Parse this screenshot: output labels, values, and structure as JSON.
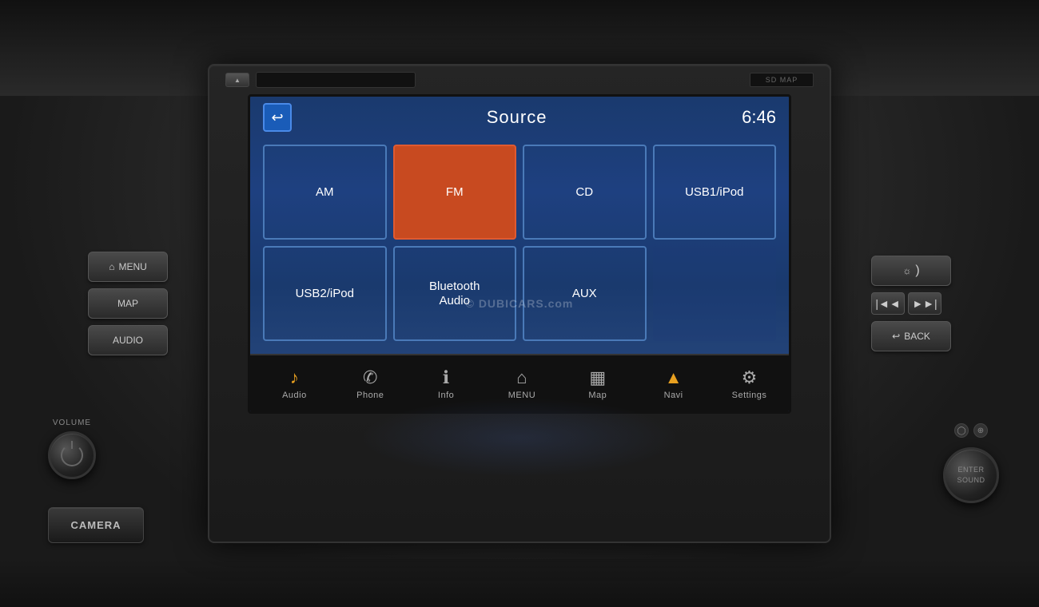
{
  "ui": {
    "screen": {
      "title": "Source",
      "time": "6:46",
      "back_label": "◁"
    },
    "source_buttons": [
      {
        "id": "am",
        "label": "AM",
        "active": false
      },
      {
        "id": "fm",
        "label": "FM",
        "active": true
      },
      {
        "id": "cd",
        "label": "CD",
        "active": false
      },
      {
        "id": "usb1",
        "label": "USB1/iPod",
        "active": false
      },
      {
        "id": "usb2",
        "label": "USB2/iPod",
        "active": false
      },
      {
        "id": "bluetooth",
        "label": "Bluetooth\nAudio",
        "active": false
      },
      {
        "id": "aux",
        "label": "AUX",
        "active": false
      }
    ],
    "nav_items": [
      {
        "id": "audio",
        "label": "Audio",
        "icon": "♪",
        "active": true
      },
      {
        "id": "phone",
        "label": "Phone",
        "icon": "✆",
        "active": false
      },
      {
        "id": "info",
        "label": "Info",
        "icon": "ℹ",
        "active": false
      },
      {
        "id": "menu",
        "label": "MENU",
        "icon": "⌂",
        "active": false
      },
      {
        "id": "map",
        "label": "Map",
        "icon": "▦",
        "active": false
      },
      {
        "id": "navi",
        "label": "Navi",
        "icon": "▲",
        "active": false
      },
      {
        "id": "settings",
        "label": "Settings",
        "icon": "⚙",
        "active": false
      }
    ],
    "left_buttons": [
      {
        "id": "menu",
        "label": "MENU",
        "icon": "⌂"
      },
      {
        "id": "map_btn",
        "label": "MAP",
        "icon": ""
      },
      {
        "id": "audio_btn",
        "label": "AUDIO",
        "icon": ""
      }
    ],
    "right_buttons": [
      {
        "id": "brightness",
        "label": "☼  )",
        "icon": ""
      },
      {
        "id": "skip_back",
        "label": "|◄◄",
        "icon": ""
      },
      {
        "id": "skip_fwd",
        "label": "►►|",
        "icon": ""
      },
      {
        "id": "back",
        "label": "↩ BACK",
        "icon": ""
      }
    ],
    "volume_label": "VOLUME",
    "camera_label": "CAMERA",
    "enter_sound_label": "ENTER\nSOUND",
    "sd_map_label": "SD MAP",
    "eject_label": "▲",
    "watermark": "© DUBICARS.com"
  }
}
